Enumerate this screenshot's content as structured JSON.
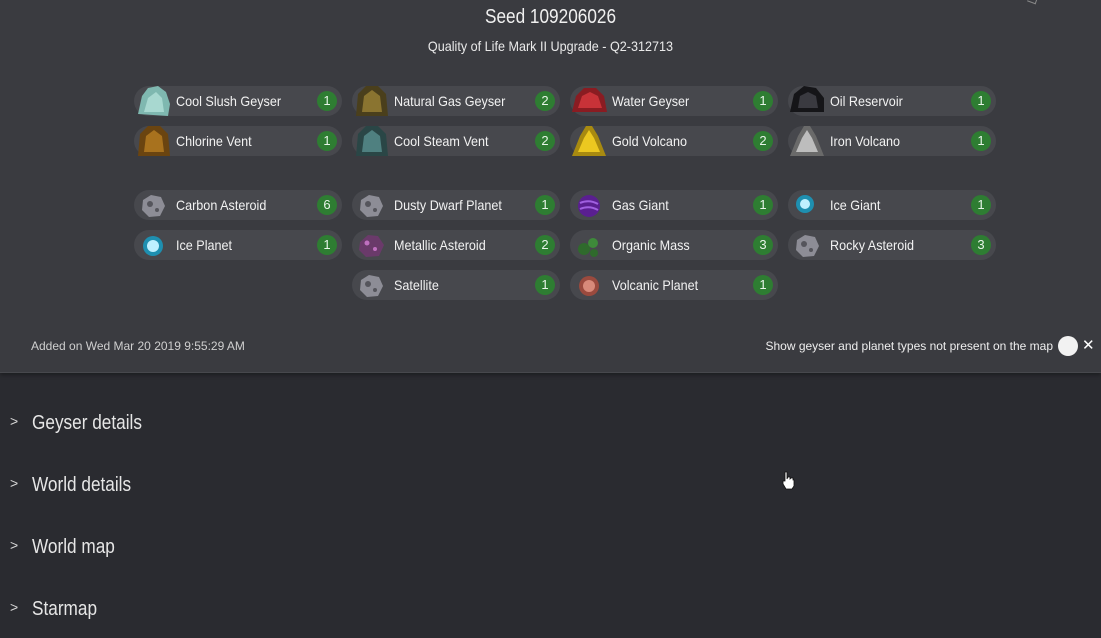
{
  "header": {
    "seed_title": "Seed 109206026",
    "subtitle": "Quality of Life Mark II Upgrade - Q2-312713"
  },
  "geysers": [
    {
      "label": "Cool Slush Geyser",
      "count": "1",
      "icon": "cool-slush-geyser-icon",
      "color": "#7fb8b0"
    },
    {
      "label": "Natural Gas Geyser",
      "count": "2",
      "icon": "natural-gas-geyser-icon",
      "color": "#6b5a2a"
    },
    {
      "label": "Water Geyser",
      "count": "1",
      "icon": "water-geyser-icon",
      "color": "#b0282f"
    },
    {
      "label": "Oil Reservoir",
      "count": "1",
      "icon": "oil-reservoir-icon",
      "color": "#222226"
    },
    {
      "label": "Chlorine Vent",
      "count": "1",
      "icon": "chlorine-vent-icon",
      "color": "#8a5a1c"
    },
    {
      "label": "Cool Steam Vent",
      "count": "2",
      "icon": "cool-steam-vent-icon",
      "color": "#3f6a6a"
    },
    {
      "label": "Gold Volcano",
      "count": "2",
      "icon": "gold-volcano-icon",
      "color": "#d4b21a"
    },
    {
      "label": "Iron Volcano",
      "count": "1",
      "icon": "iron-volcano-icon",
      "color": "#9a9a9a"
    }
  ],
  "planets": [
    {
      "label": "Carbon Asteroid",
      "count": "6",
      "icon": "carbon-asteroid-icon",
      "color": "#8d8d96"
    },
    {
      "label": "Dusty Dwarf Planet",
      "count": "1",
      "icon": "dusty-dwarf-planet-icon",
      "color": "#8d8d96"
    },
    {
      "label": "Gas Giant",
      "count": "1",
      "icon": "gas-giant-icon",
      "color": "#6a2aa0"
    },
    {
      "label": "Ice Giant",
      "count": "1",
      "icon": "ice-giant-icon",
      "color": "#3ab8d8"
    },
    {
      "label": "Ice Planet",
      "count": "1",
      "icon": "ice-planet-icon",
      "color": "#3ab8d8"
    },
    {
      "label": "Metallic Asteroid",
      "count": "2",
      "icon": "metallic-asteroid-icon",
      "color": "#7a4a7a"
    },
    {
      "label": "Organic Mass",
      "count": "3",
      "icon": "organic-mass-icon",
      "color": "#3e7a3a"
    },
    {
      "label": "Rocky Asteroid",
      "count": "3",
      "icon": "rocky-asteroid-icon",
      "color": "#8d8d96"
    },
    {
      "label": "Satellite",
      "count": "1",
      "icon": "satellite-icon",
      "color": "#8d8d96"
    },
    {
      "label": "Volcanic Planet",
      "count": "1",
      "icon": "volcanic-planet-icon",
      "color": "#c07060"
    }
  ],
  "footer": {
    "added_on": "Added on Wed Mar 20 2019 9:55:29 AM",
    "toggle_label": "Show geyser and planet types not present on the map",
    "toggle_close": "✕"
  },
  "sections": [
    {
      "title": "Geyser details",
      "chevron": ">"
    },
    {
      "title": "World details",
      "chevron": ">"
    },
    {
      "title": "World map",
      "chevron": ">"
    },
    {
      "title": "Starmap",
      "chevron": ">"
    }
  ],
  "colors": {
    "count_badge": "#2e7d32",
    "panel": "#3a3b40",
    "chip": "#47484d",
    "background": "#2a2b30"
  }
}
